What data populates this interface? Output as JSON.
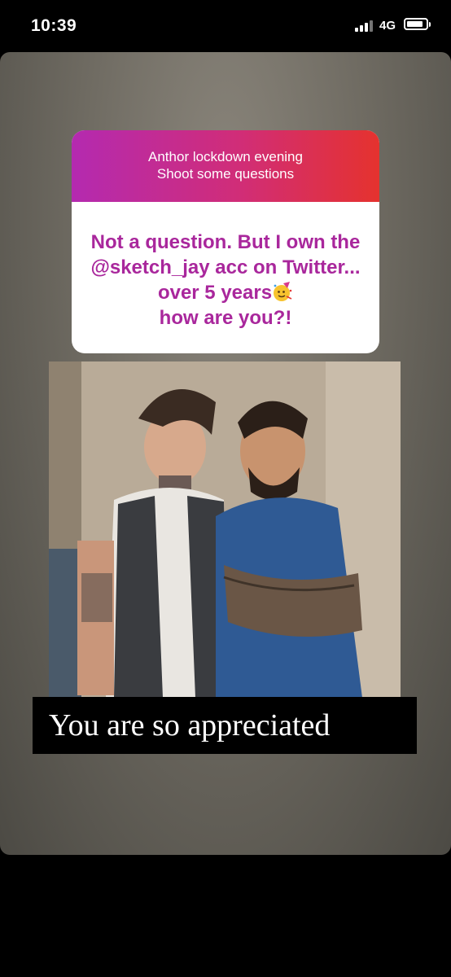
{
  "status_bar": {
    "time": "10:39",
    "network": "4G",
    "icons": [
      "signal-icon",
      "battery-icon"
    ]
  },
  "story": {
    "question_prompt_line1": "Anthor lockdown evening",
    "question_prompt_line2": "Shoot some questions",
    "answer_text": "Not a question. But I own the @sketch_jay acc on Twitter... over 5 years",
    "answer_text_tail": "how are you?!",
    "emoji": "party-face-icon",
    "caption": "You are so appreciated",
    "colors": {
      "gradient_start": "#b42ab0",
      "gradient_end": "#e5322e",
      "answer_color": "#a9279c"
    }
  }
}
